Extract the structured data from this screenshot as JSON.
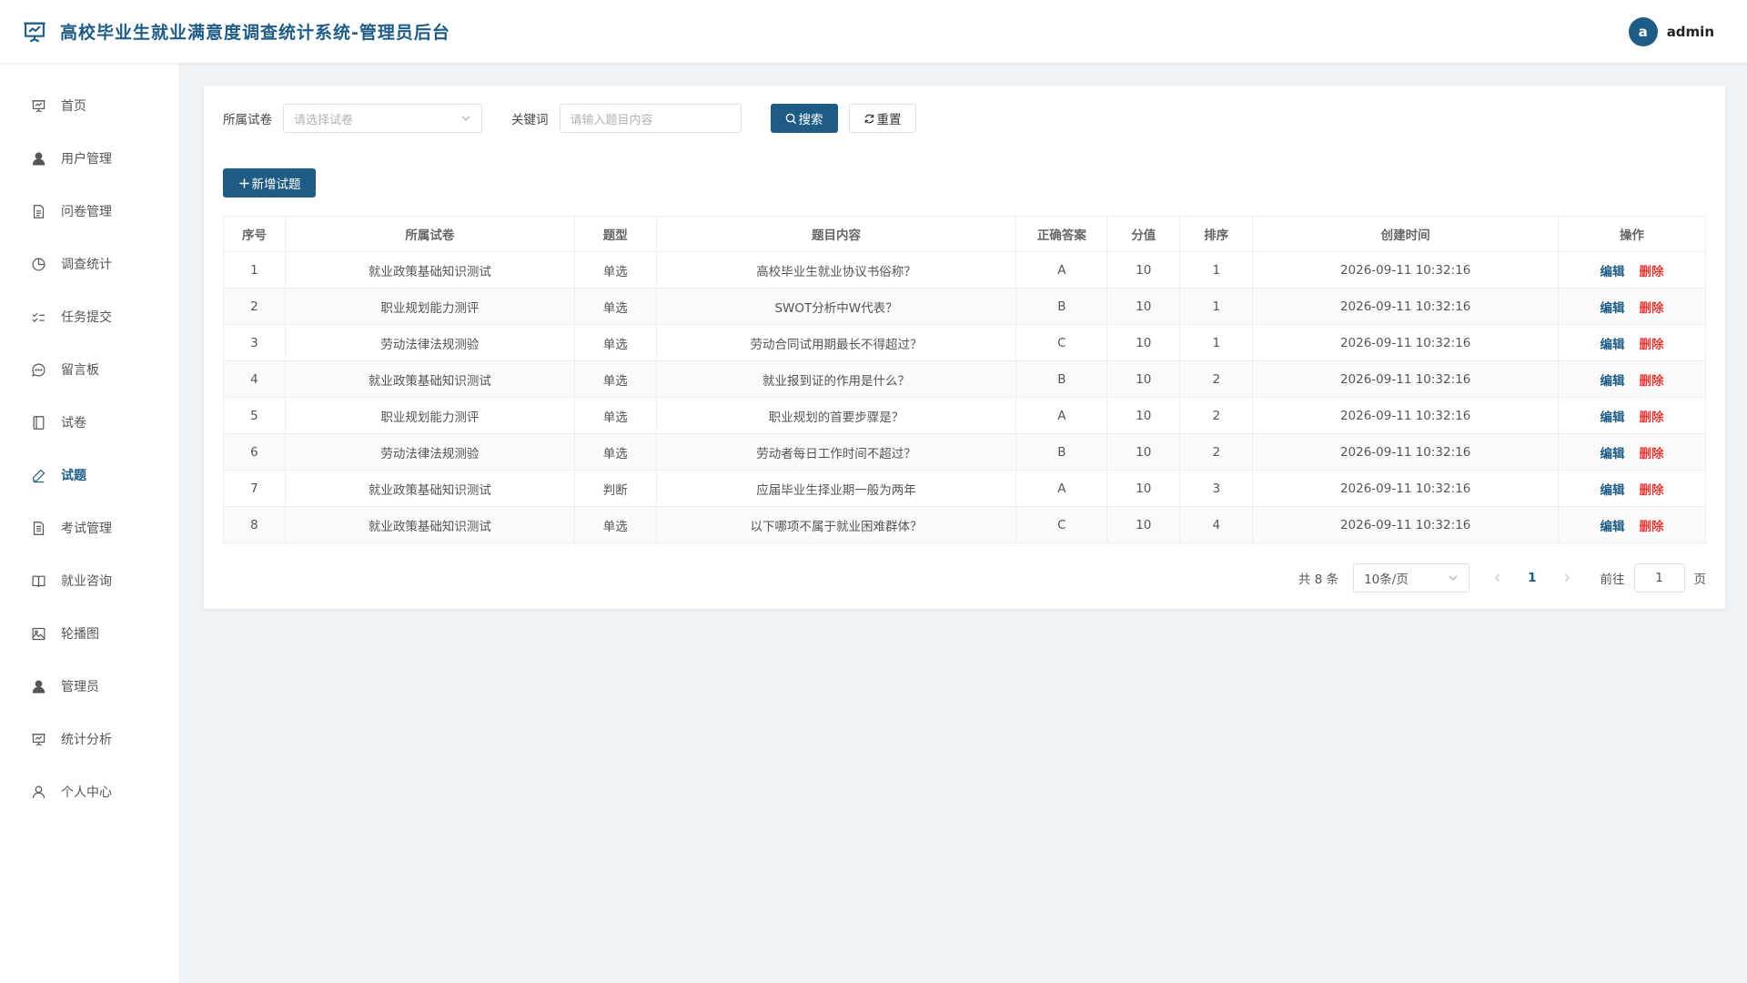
{
  "header": {
    "title": "高校毕业生就业满意度调查统计系统-管理员后台",
    "avatar_letter": "a",
    "username": "admin"
  },
  "sidebar": {
    "items": [
      {
        "label": "首页",
        "icon": "presentation-icon"
      },
      {
        "label": "用户管理",
        "icon": "user-icon"
      },
      {
        "label": "问卷管理",
        "icon": "document-icon"
      },
      {
        "label": "调查统计",
        "icon": "pie-chart-icon"
      },
      {
        "label": "任务提交",
        "icon": "checklist-icon"
      },
      {
        "label": "留言板",
        "icon": "chat-icon"
      },
      {
        "label": "试卷",
        "icon": "notebook-icon"
      },
      {
        "label": "试题",
        "icon": "pen-icon"
      },
      {
        "label": "考试管理",
        "icon": "file-list-icon"
      },
      {
        "label": "就业咨询",
        "icon": "book-icon"
      },
      {
        "label": "轮播图",
        "icon": "picture-icon"
      },
      {
        "label": "管理员",
        "icon": "user-filled-icon"
      },
      {
        "label": "统计分析",
        "icon": "presentation-icon"
      },
      {
        "label": "个人中心",
        "icon": "user-outline-icon"
      }
    ],
    "active": "试题"
  },
  "filters": {
    "paper_label": "所属试卷",
    "paper_placeholder": "请选择试卷",
    "keyword_label": "关键词",
    "keyword_placeholder": "请输入题目内容",
    "search_label": "搜索",
    "reset_label": "重置"
  },
  "add_button_label": "新增试题",
  "table": {
    "columns": [
      "序号",
      "所属试卷",
      "题型",
      "题目内容",
      "正确答案",
      "分值",
      "排序",
      "创建时间",
      "操作"
    ],
    "rows": [
      [
        "1",
        "就业政策基础知识测试",
        "单选",
        "高校毕业生就业协议书俗称？",
        "A",
        "10",
        "1",
        "2026-09-11 10:32:16"
      ],
      [
        "2",
        "职业规划能力测评",
        "单选",
        "SWOT分析中W代表？",
        "B",
        "10",
        "1",
        "2026-09-11 10:32:16"
      ],
      [
        "3",
        "劳动法律法规测验",
        "单选",
        "劳动合同试用期最长不得超过？",
        "C",
        "10",
        "1",
        "2026-09-11 10:32:16"
      ],
      [
        "4",
        "就业政策基础知识测试",
        "单选",
        "就业报到证的作用是什么？",
        "B",
        "10",
        "2",
        "2026-09-11 10:32:16"
      ],
      [
        "5",
        "职业规划能力测评",
        "单选",
        "职业规划的首要步骤是？",
        "A",
        "10",
        "2",
        "2026-09-11 10:32:16"
      ],
      [
        "6",
        "劳动法律法规测验",
        "单选",
        "劳动者每日工作时间不超过？",
        "B",
        "10",
        "2",
        "2026-09-11 10:32:16"
      ],
      [
        "7",
        "就业政策基础知识测试",
        "判断",
        "应届毕业生择业期一般为两年",
        "A",
        "10",
        "3",
        "2026-09-11 10:32:16"
      ],
      [
        "8",
        "就业政策基础知识测试",
        "单选",
        "以下哪项不属于就业困难群体？",
        "C",
        "10",
        "4",
        "2026-09-11 10:32:16"
      ]
    ],
    "edit_label": "编辑",
    "delete_label": "删除"
  },
  "pagination": {
    "total_text": "共 8 条",
    "page_size": "10条/页",
    "current_page": "1",
    "goto_label": "前往",
    "goto_value": "1",
    "page_suffix": "页"
  },
  "colors": {
    "primary": "#1e5c86",
    "danger": "#e53935",
    "background": "#eff2f6"
  }
}
